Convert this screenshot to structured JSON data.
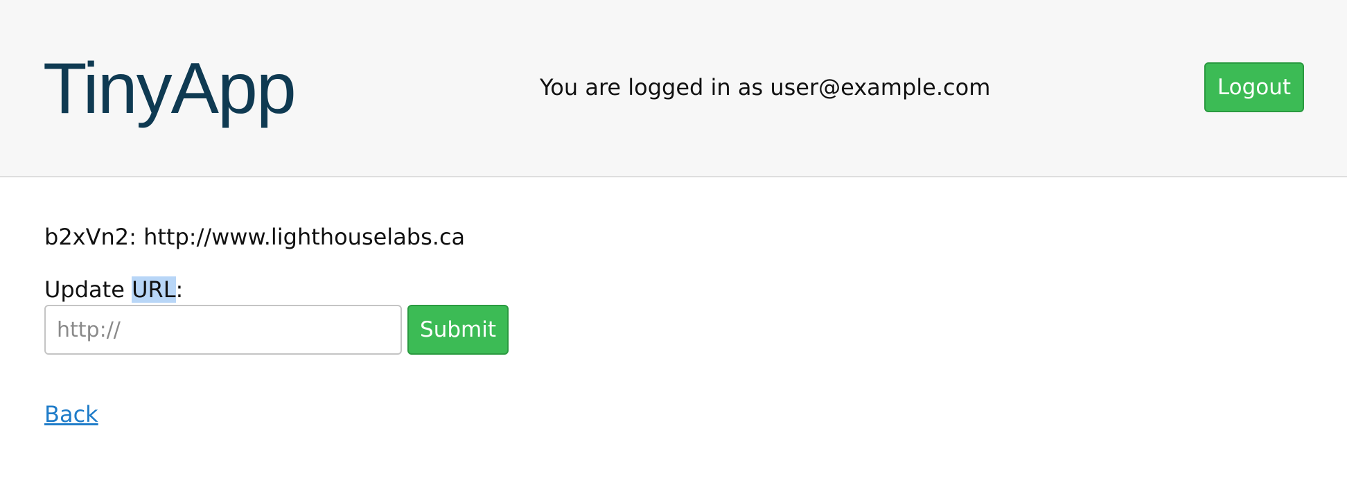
{
  "header": {
    "brand": "TinyApp",
    "login_status": "You are logged in as user@example.com",
    "logout_label": "Logout"
  },
  "main": {
    "short_id": "b2xVn2",
    "long_url": "http://www.lighthouselabs.ca",
    "update_label_prefix": "Update ",
    "update_label_highlight": "URL",
    "update_label_suffix": ":",
    "url_input": {
      "value": "",
      "placeholder": "http://"
    },
    "submit_label": "Submit",
    "back_label": "Back"
  },
  "colors": {
    "brand": "#0f3a52",
    "button": "#3cbb55",
    "link": "#1f7cc9",
    "header_bg": "#f7f7f7",
    "selection": "#b8d6f7"
  }
}
